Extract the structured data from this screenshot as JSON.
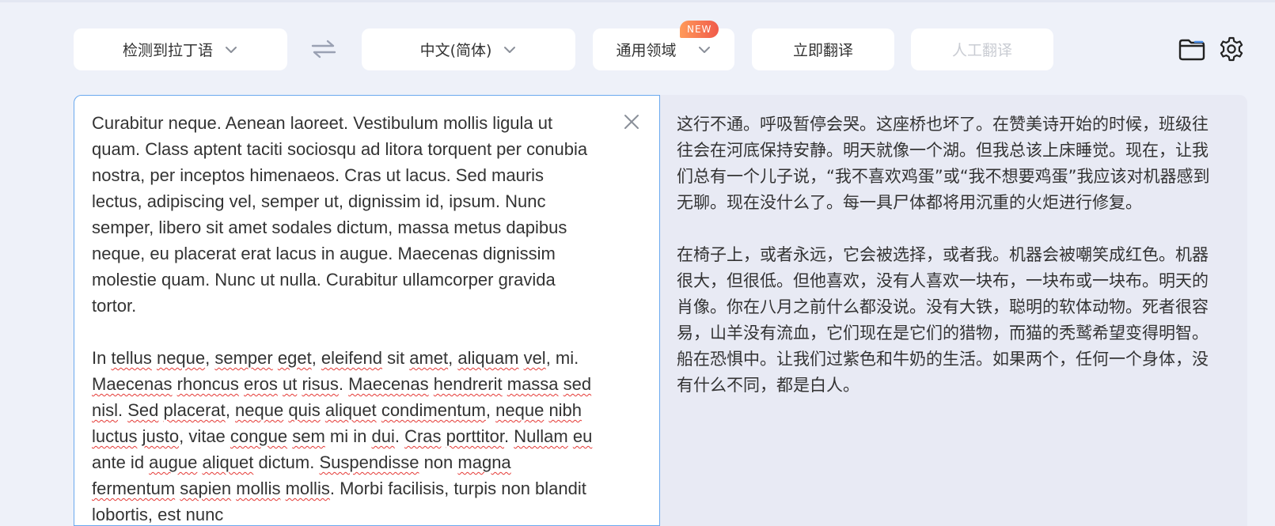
{
  "toolbar": {
    "source_language": "检测到拉丁语",
    "target_language": "中文(简体)",
    "domain": "通用领域",
    "new_badge": "NEW",
    "translate_now": "立即翻译",
    "human_translation": "人工翻译"
  },
  "colors": {
    "accent_border": "#6aa9ef",
    "badge_gradient_start": "#ff9a5a",
    "badge_gradient_end": "#f05a4a",
    "spellcheck_underline": "#e53935",
    "disabled_text": "#c9ccd3"
  },
  "icons": [
    "swap-languages-icon",
    "chevron-down-icon",
    "folder-icon",
    "gear-icon",
    "close-icon"
  ],
  "source": {
    "paragraph_1": " Curabitur neque. Aenean laoreet. Vestibulum mollis ligula ut quam. Class aptent taciti sociosqu ad litora torquent per conubia nostra, per inceptos himenaeos. Cras ut lacus. Sed mauris lectus, adipiscing vel, semper ut, dignissim id, ipsum. Nunc semper, libero sit amet sodales dictum, massa metus dapibus neque, eu placerat erat lacus in augue. Maecenas dignissim molestie quam. Nunc ut nulla. Curabitur ullamcorper gravida tortor.",
    "paragraph_2_words": [
      "In ",
      "tellus",
      " ",
      "neque",
      ", ",
      "semper",
      " ",
      "eget",
      ", ",
      "eleifend",
      " sit ",
      "amet",
      ", ",
      "aliquam",
      " ",
      "vel",
      ", mi. ",
      "Maecenas",
      " ",
      "rhoncus",
      " ",
      "eros",
      " ",
      "ut",
      " ",
      "risus",
      ". ",
      "Maecenas",
      " ",
      "hendrerit",
      " ",
      "massa",
      " ",
      "sed",
      " ",
      "nisl",
      ". ",
      "Sed",
      " ",
      "placerat",
      ", ",
      "neque",
      " ",
      "quis",
      " ",
      "aliquet",
      " ",
      "condimentum",
      ", ",
      "neque",
      " ",
      "nibh",
      " ",
      "luctus",
      " ",
      "justo",
      ", vitae ",
      "congue",
      " ",
      "sem",
      " mi in ",
      "dui",
      ". ",
      "Cras",
      " ",
      "porttitor",
      ". ",
      "Nullam",
      " ",
      "eu",
      " ante id ",
      "augue",
      " ",
      "aliquet",
      " dictum. ",
      "Suspendisse",
      " non ",
      "magna",
      " ",
      "fermentum",
      " ",
      "sapien",
      " ",
      "mollis",
      " ",
      "mollis",
      ". Morbi facilisis, turpis non blandit lobortis, est nunc"
    ]
  },
  "target": {
    "paragraph_1": "这行不通。呼吸暂停会哭。这座桥也坏了。在赞美诗开始的时候，班级往往会在河底保持安静。明天就像一个湖。但我总该上床睡觉。现在，让我们总有一个儿子说，“我不喜欢鸡蛋”或“我不想要鸡蛋”我应该对机器感到无聊。现在没什么了。每一具尸体都将用沉重的火炬进行修复。",
    "paragraph_2": "在椅子上，或者永远，它会被选择，或者我。机器会被嘲笑成红色。机器很大，但很低。但他喜欢，没有人喜欢一块布，一块布或一块布。明天的肖像。你在八月之前什么都没说。没有大铁，聪明的软体动物。死者很容易，山羊没有流血，它们现在是它们的猎物，而猫的秃鹫希望变得明智。船在恐惧中。让我们过紫色和牛奶的生活。如果两个，任何一个身体，没有什么不同，都是白人。"
  }
}
